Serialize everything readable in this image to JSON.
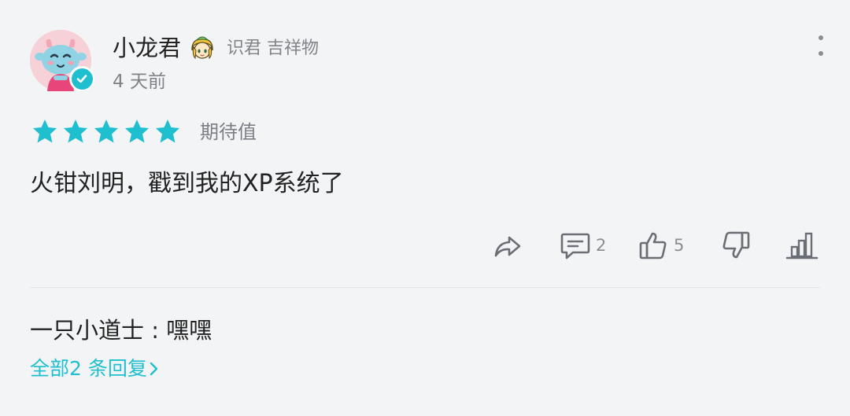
{
  "author": {
    "name": "小龙君",
    "tag": "识君 吉祥物",
    "time": "4 天前",
    "verified": true
  },
  "rating": {
    "stars": 5,
    "max": 5,
    "label": "期待值"
  },
  "comment": {
    "text": "火钳刘明，戳到我的XP系统了"
  },
  "actions": {
    "share_icon": "share-icon",
    "comment_icon": "comment-icon",
    "comment_count": "2",
    "like_icon": "thumbs-up-icon",
    "like_count": "5",
    "dislike_icon": "thumbs-down-icon",
    "stats_icon": "bar-chart-icon"
  },
  "replies": {
    "preview": "一只小道士 : 嘿嘿",
    "view_all": "全部2 条回复"
  },
  "colors": {
    "accent": "#1fbfd0",
    "background": "#f3f4f6",
    "muted": "#808489",
    "text": "#222222"
  }
}
